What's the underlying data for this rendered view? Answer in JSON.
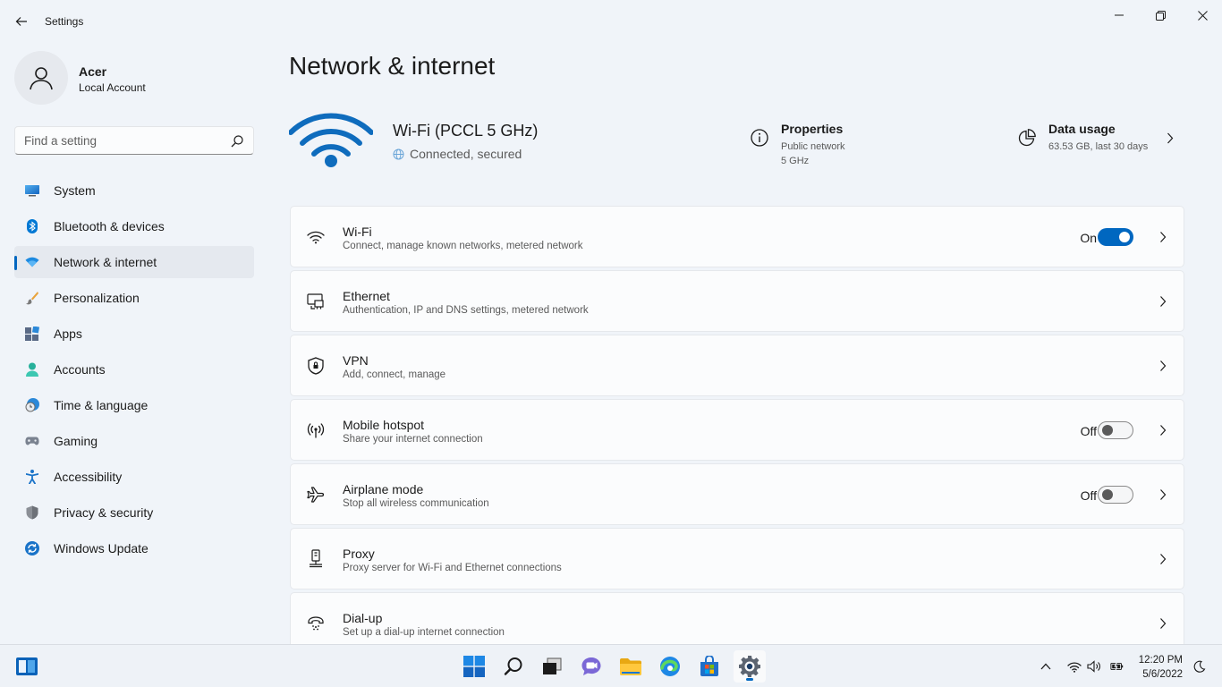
{
  "window": {
    "title": "Settings"
  },
  "profile": {
    "name": "Acer",
    "account_type": "Local Account"
  },
  "search": {
    "placeholder": "Find a setting"
  },
  "sidebar": {
    "items": [
      {
        "label": "System",
        "icon": "system-icon"
      },
      {
        "label": "Bluetooth & devices",
        "icon": "bluetooth-icon"
      },
      {
        "label": "Network & internet",
        "icon": "network-icon",
        "active": true
      },
      {
        "label": "Personalization",
        "icon": "brush-icon"
      },
      {
        "label": "Apps",
        "icon": "apps-icon"
      },
      {
        "label": "Accounts",
        "icon": "accounts-icon"
      },
      {
        "label": "Time & language",
        "icon": "time-language-icon"
      },
      {
        "label": "Gaming",
        "icon": "gaming-icon"
      },
      {
        "label": "Accessibility",
        "icon": "accessibility-icon"
      },
      {
        "label": "Privacy & security",
        "icon": "shield-icon"
      },
      {
        "label": "Windows Update",
        "icon": "windows-update-icon"
      }
    ]
  },
  "main": {
    "title": "Network & internet",
    "connection": {
      "name": "Wi-Fi (PCCL 5 GHz)",
      "status": "Connected, secured"
    },
    "properties": {
      "title": "Properties",
      "line1": "Public network",
      "line2": "5 GHz"
    },
    "data_usage": {
      "title": "Data usage",
      "line1": "63.53 GB, last 30 days"
    },
    "cards": [
      {
        "title": "Wi-Fi",
        "subtitle": "Connect, manage known networks, metered network",
        "toggle": "On",
        "icon": "wifi-icon"
      },
      {
        "title": "Ethernet",
        "subtitle": "Authentication, IP and DNS settings, metered network",
        "icon": "ethernet-icon"
      },
      {
        "title": "VPN",
        "subtitle": "Add, connect, manage",
        "icon": "vpn-shield-icon"
      },
      {
        "title": "Mobile hotspot",
        "subtitle": "Share your internet connection",
        "toggle": "Off",
        "icon": "hotspot-icon"
      },
      {
        "title": "Airplane mode",
        "subtitle": "Stop all wireless communication",
        "toggle": "Off",
        "icon": "airplane-icon"
      },
      {
        "title": "Proxy",
        "subtitle": "Proxy server for Wi-Fi and Ethernet connections",
        "icon": "proxy-icon"
      },
      {
        "title": "Dial-up",
        "subtitle": "Set up a dial-up internet connection",
        "icon": "dialup-icon"
      }
    ]
  },
  "taskbar": {
    "time": "12:20 PM",
    "date": "5/6/2022"
  },
  "colors": {
    "accent": "#0067c0",
    "wifi_hero": "#0f6cbd",
    "background": "#f0f4f9"
  }
}
